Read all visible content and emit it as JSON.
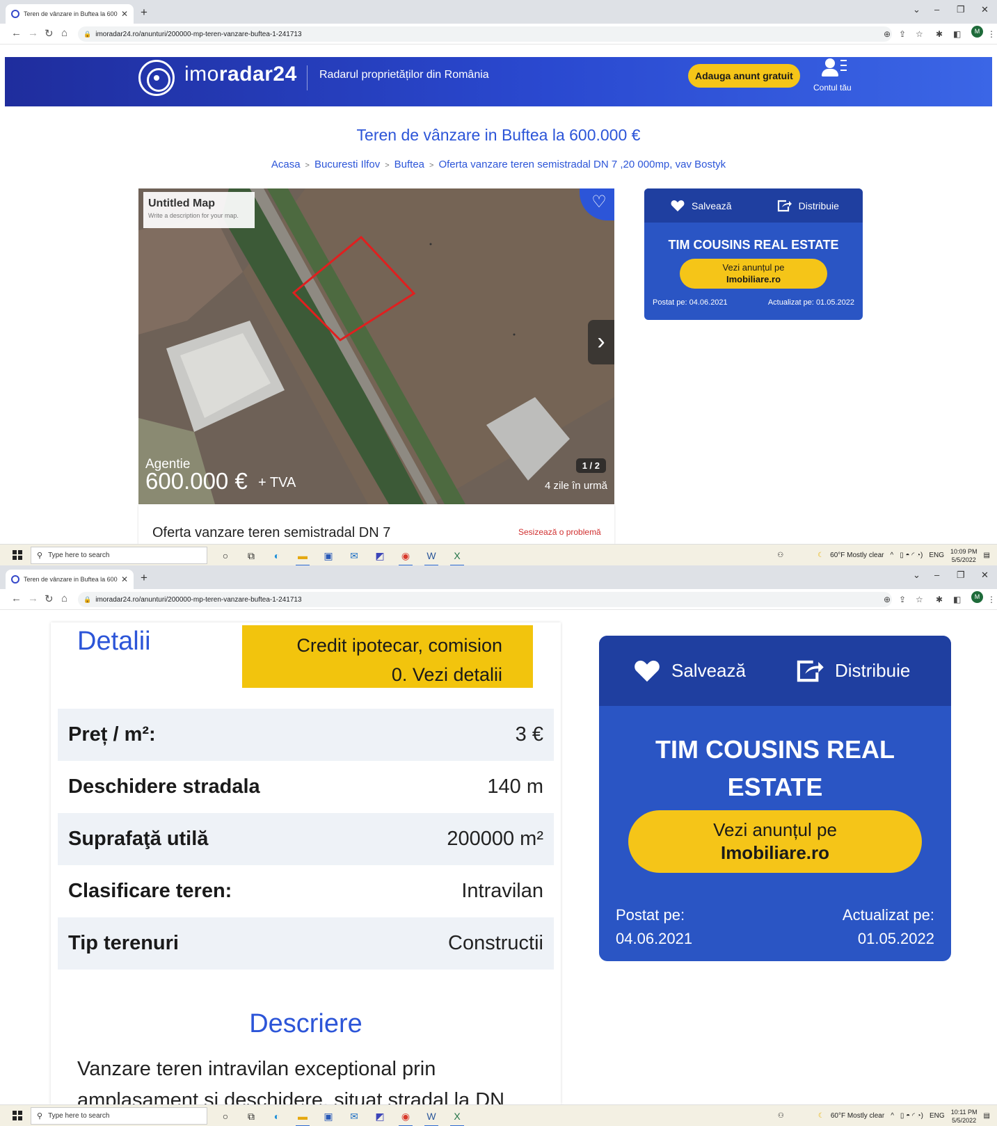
{
  "browser": {
    "tab_title": "Teren de vânzare in Buftea la 600",
    "url": "imoradar24.ro/anunturi/200000-mp-teren-vanzare-buftea-1-241713",
    "profile_initial": "M"
  },
  "header": {
    "logo_prefix": "imo",
    "logo_bold": "radar24",
    "tagline": "Radarul proprietăților din România",
    "add_ad_label": "Adauga anunt gratuit",
    "account_label": "Contul tău"
  },
  "page": {
    "title": "Teren de vânzare in Buftea la 600.000 €",
    "breadcrumb": [
      "Acasa",
      "Bucuresti Ilfov",
      "Buftea",
      "Oferta vanzare teren semistradal DN 7 ,20 000mp, vav Bostyk"
    ]
  },
  "gallery": {
    "map_title": "Untitled Map",
    "map_description": "Write a description for your map.",
    "agent_label": "Agentie",
    "price": "600.000 €",
    "price_suffix": "+ TVA",
    "counter": "1 / 2",
    "posted_ago": "4 zile în urmă",
    "listing_name": "Oferta vanzare teren semistradal DN 7",
    "report_link": "Sesizează o problemă"
  },
  "agency": {
    "save_label": "Salvează",
    "share_label": "Distribuie",
    "name": "TIM COUSINS REAL ESTATE",
    "cta_line1": "Vezi anunțul pe",
    "cta_line2": "Imobiliare.ro",
    "posted_label": "Postat pe:",
    "posted_date": "04.06.2021",
    "updated_label": "Actualizat pe:",
    "updated_date": "01.05.2022"
  },
  "details": {
    "heading": "Detalii",
    "credit_line1": "Credit ipotecar, comision",
    "credit_line2": "0. Vezi detalii",
    "rows": [
      {
        "label": "Preț / m²:",
        "value": "3 €"
      },
      {
        "label": "Deschidere stradala",
        "value": "140 m"
      },
      {
        "label": "Suprafaţă utilă",
        "value": "200000 m²"
      },
      {
        "label": "Clasificare teren:",
        "value": "Intravilan"
      },
      {
        "label": "Tip terenuri",
        "value": "Constructii"
      }
    ],
    "description_heading": "Descriere",
    "description_text": "Vanzare teren intravilan exceptional prin amplasament si deschidere, situat stradal la DN"
  },
  "taskbar": {
    "search_placeholder": "Type here to search",
    "weather": "60°F  Mostly clear",
    "lang": "ENG",
    "time1": "10:09 PM",
    "time2": "10:11 PM",
    "date": "5/5/2022"
  },
  "colors": {
    "brand_blue": "#2c55d8",
    "header_dark": "#1f2d9d",
    "accent_yellow": "#f5c518",
    "card_blue": "#2a55c4"
  }
}
